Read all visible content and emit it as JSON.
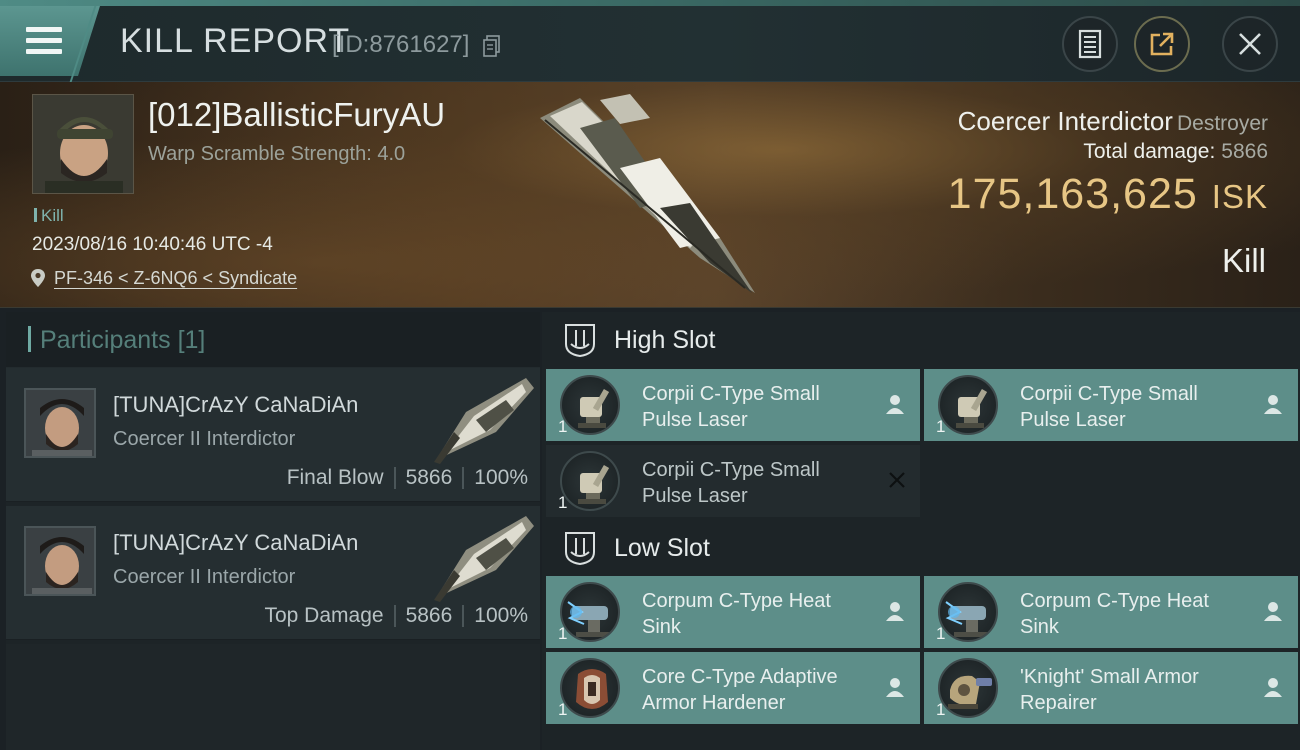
{
  "header": {
    "title": "KILL REPORT",
    "report_id": "[ID:8761627]"
  },
  "victim": {
    "name": "[012]BallisticFuryAU",
    "warp_scramble": "Warp Scramble Strength: 4.0",
    "tag": "Kill",
    "datetime": "2023/08/16 10:40:46 UTC -4",
    "location": "PF-346 < Z-6NQ6 < Syndicate",
    "ship_name": "Coercer Interdictor",
    "ship_class": "Destroyer",
    "total_damage_label": "Total damage:",
    "total_damage": "5866",
    "isk_value": "175,163,625",
    "isk_unit": "ISK",
    "result": "Kill"
  },
  "participants": {
    "title": "Participants",
    "count": "[1]",
    "items": [
      {
        "name": "[TUNA]CrAzY CaNaDiAn",
        "ship": "Coercer II Interdictor",
        "role": "Final Blow",
        "damage": "5866",
        "percent": "100%"
      },
      {
        "name": "[TUNA]CrAzY CaNaDiAn",
        "ship": "Coercer II Interdictor",
        "role": "Top Damage",
        "damage": "5866",
        "percent": "100%"
      }
    ]
  },
  "fitting": {
    "high_slot": {
      "title": "High Slot",
      "modules": [
        {
          "name": "Corpii C-Type Small Pulse Laser",
          "qty": "1",
          "status": "person-icon"
        },
        {
          "name": "Corpii C-Type Small Pulse Laser",
          "qty": "1",
          "status": "person-icon"
        },
        {
          "name": "Corpii C-Type Small Pulse Laser",
          "qty": "1",
          "status": "close-icon"
        }
      ]
    },
    "low_slot": {
      "title": "Low Slot",
      "modules": [
        {
          "name": "Corpum C-Type Heat Sink",
          "qty": "1",
          "status": "person-icon"
        },
        {
          "name": "Corpum C-Type Heat Sink",
          "qty": "1",
          "status": "person-icon"
        },
        {
          "name": "Core C-Type Adaptive Armor Hardener",
          "qty": "1",
          "status": "person-icon"
        },
        {
          "name": "'Knight' Small Armor Repairer",
          "qty": "1",
          "status": "person-icon"
        }
      ]
    }
  },
  "colors": {
    "accent": "#5d8e89",
    "isk": "#e7c685",
    "header_teal": "#4f8b85"
  }
}
